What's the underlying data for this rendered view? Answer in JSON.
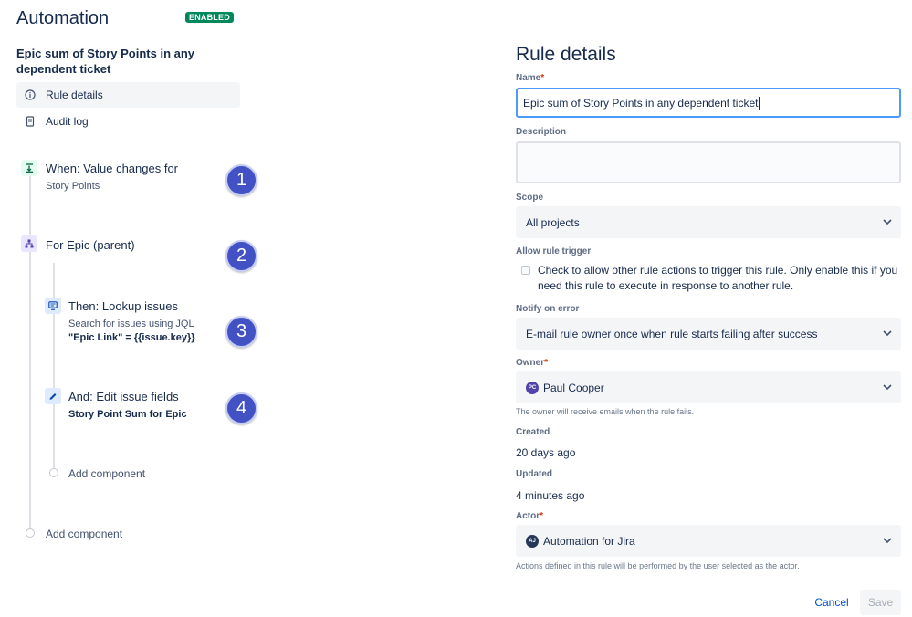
{
  "header": {
    "title": "Automation",
    "status": "ENABLED",
    "status_color": "#00875a"
  },
  "sidebar": {
    "rule_name": "Epic sum of Story Points in any dependent ticket",
    "nav": [
      {
        "label": "Rule details",
        "icon": "info-icon",
        "active": true
      },
      {
        "label": "Audit log",
        "icon": "document-icon",
        "active": false
      }
    ]
  },
  "flow": {
    "trigger": {
      "title": "When: Value changes for",
      "subtitle": "Story Points",
      "icon": "trigger-icon"
    },
    "branch": {
      "title": "For Epic (parent)",
      "icon": "branch-icon"
    },
    "lookup": {
      "title": "Then: Lookup issues",
      "subtitle": "Search for issues using JQL",
      "jql": "\"Epic Link\" = {{issue.key}}",
      "icon": "lookup-icon"
    },
    "edit": {
      "title": "And: Edit issue fields",
      "subtitle": "Story Point Sum for Epic",
      "icon": "pencil-icon"
    },
    "add_inner": "Add component",
    "add_outer": "Add component",
    "badges": [
      "1",
      "2",
      "3",
      "4"
    ],
    "badge_color": "#4252c5"
  },
  "details": {
    "heading": "Rule details",
    "name_label": "Name",
    "name_value": "Epic sum of Story Points in any dependent ticket",
    "description_label": "Description",
    "description_value": "",
    "scope_label": "Scope",
    "scope_value": "All projects",
    "allow_trigger_label": "Allow rule trigger",
    "allow_trigger_text": "Check to allow other rule actions to trigger this rule. Only enable this if you need this rule to execute in response to another rule.",
    "allow_trigger_checked": false,
    "notify_label": "Notify on error",
    "notify_value": "E-mail rule owner once when rule starts failing after success",
    "owner_label": "Owner",
    "owner_initials": "PC",
    "owner_value": "Paul Cooper",
    "owner_helper": "The owner will receive emails when the rule fails.",
    "created_label": "Created",
    "created_value": "20 days ago",
    "updated_label": "Updated",
    "updated_value": "4 minutes ago",
    "actor_label": "Actor",
    "actor_initials": "AJ",
    "actor_value": "Automation for Jira",
    "actor_helper": "Actions defined in this rule will be performed by the user selected as the actor.",
    "required_mark": "*"
  },
  "footer": {
    "cancel": "Cancel",
    "save": "Save"
  }
}
